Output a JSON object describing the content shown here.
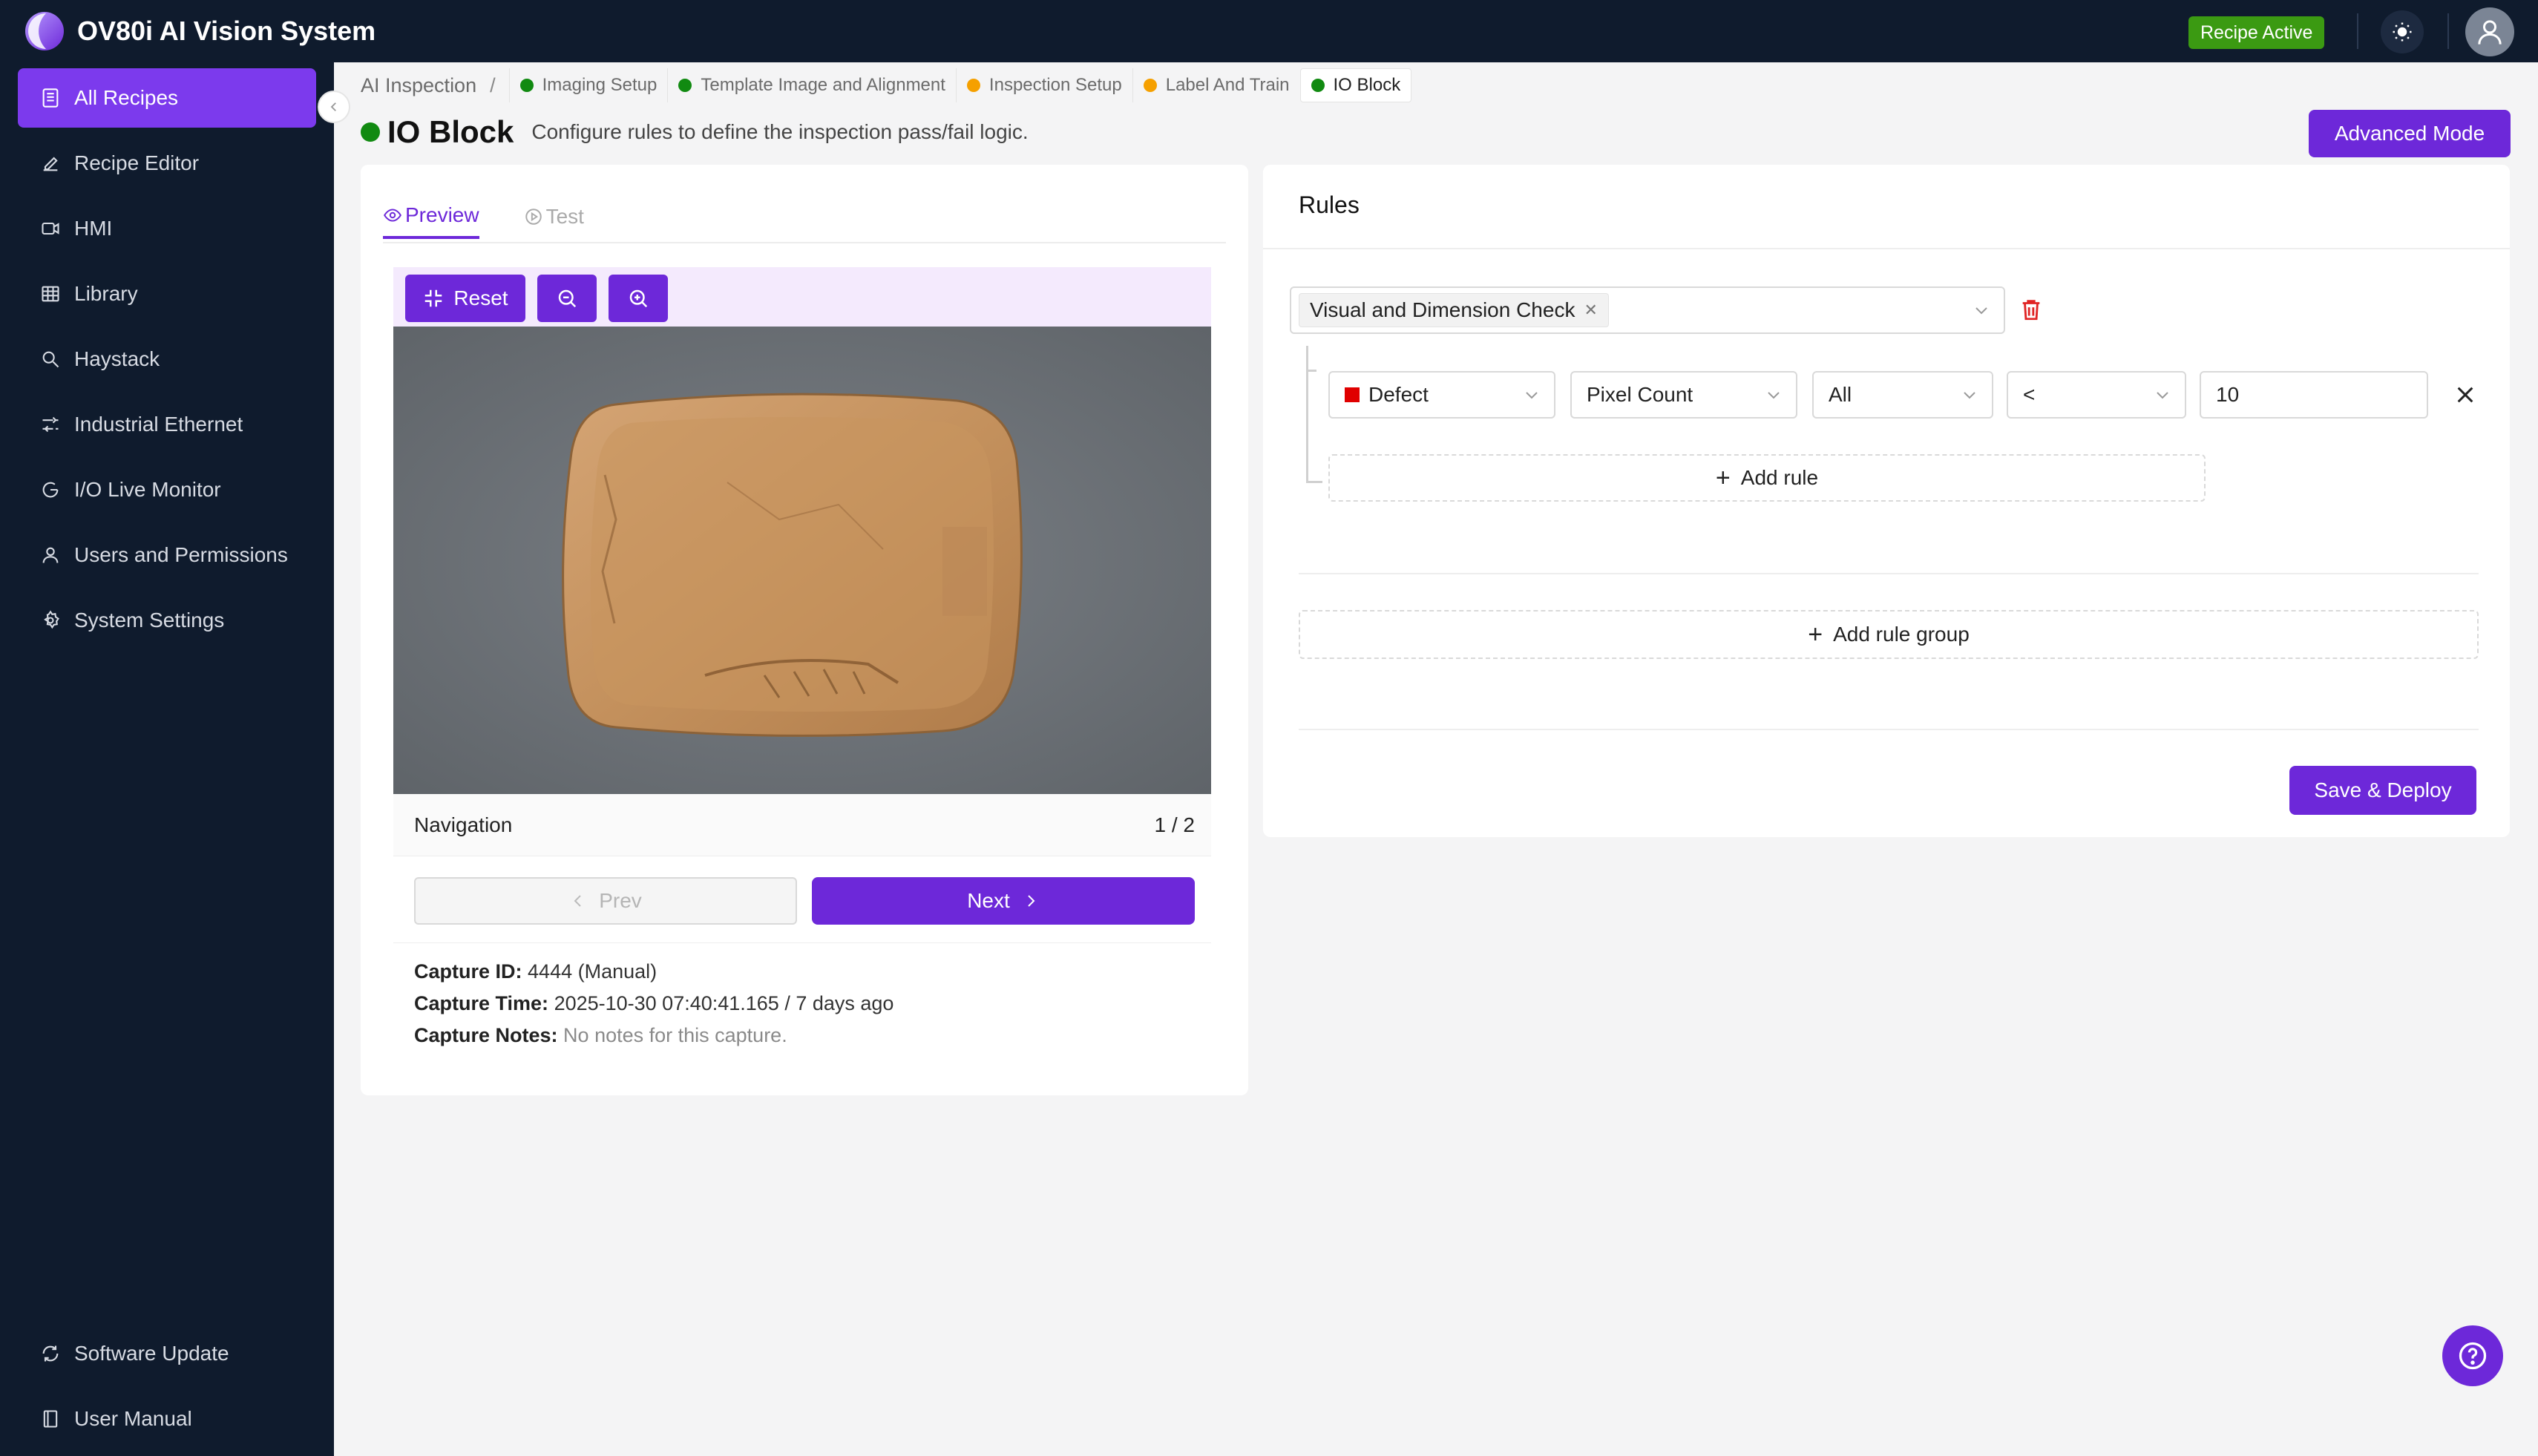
{
  "app": {
    "title": "OV80i AI Vision System",
    "status_badge": "Recipe Active",
    "colors": {
      "accent": "#6d28d9",
      "nav_bg": "#0f1b2d",
      "active_badge": "#3b9a12"
    }
  },
  "sidebar": {
    "items": [
      {
        "label": "All Recipes",
        "icon": "document-list-icon",
        "active": true
      },
      {
        "label": "Recipe Editor",
        "icon": "pencil-icon"
      },
      {
        "label": "HMI",
        "icon": "video-camera-icon"
      },
      {
        "label": "Library",
        "icon": "table-grid-icon"
      },
      {
        "label": "Haystack",
        "icon": "search-icon"
      },
      {
        "label": "Industrial Ethernet",
        "icon": "network-icon"
      },
      {
        "label": "I/O Live Monitor",
        "icon": "monitor-icon"
      },
      {
        "label": "Users and Permissions",
        "icon": "user-icon"
      },
      {
        "label": "System Settings",
        "icon": "gear-icon"
      }
    ],
    "footer": [
      {
        "label": "Software Update",
        "icon": "sync-icon"
      },
      {
        "label": "User Manual",
        "icon": "book-icon"
      }
    ]
  },
  "breadcrumb": {
    "root": "AI Inspection",
    "separator": "/",
    "steps": [
      {
        "label": "Imaging Setup",
        "status_color": "#118a11"
      },
      {
        "label": "Template Image and Alignment",
        "status_color": "#118a11"
      },
      {
        "label": "Inspection Setup",
        "status_color": "#f5a000"
      },
      {
        "label": "Label And Train",
        "status_color": "#f5a000"
      },
      {
        "label": "IO Block",
        "status_color": "#118a11",
        "current": true
      }
    ]
  },
  "page": {
    "title": "IO Block",
    "subtitle": "Configure rules to define the inspection pass/fail logic.",
    "advanced_button": "Advanced Mode"
  },
  "preview": {
    "tabs": [
      {
        "label": "Preview",
        "icon": "eye-icon",
        "active": true
      },
      {
        "label": "Test",
        "icon": "play-circle-icon"
      }
    ],
    "toolbar": {
      "reset_label": "Reset"
    },
    "navigation_label": "Navigation",
    "page_indicator": "1 / 2",
    "prev_label": "Prev",
    "next_label": "Next",
    "capture": {
      "id_label": "Capture ID:",
      "id_value": "4444 (Manual)",
      "time_label": "Capture Time:",
      "time_value": "2025-10-30 07:40:41.165 / 7 days ago",
      "notes_label": "Capture Notes:",
      "notes_value": "No notes for this capture."
    }
  },
  "rules": {
    "title": "Rules",
    "group_tag": "Visual and Dimension Check",
    "rule": {
      "class": "Defect",
      "class_color": "#e00000",
      "metric": "Pixel Count",
      "scope": "All",
      "operator": "<",
      "value": "10"
    },
    "add_rule_label": "Add rule",
    "add_group_label": "Add rule group",
    "save_label": "Save & Deploy"
  }
}
